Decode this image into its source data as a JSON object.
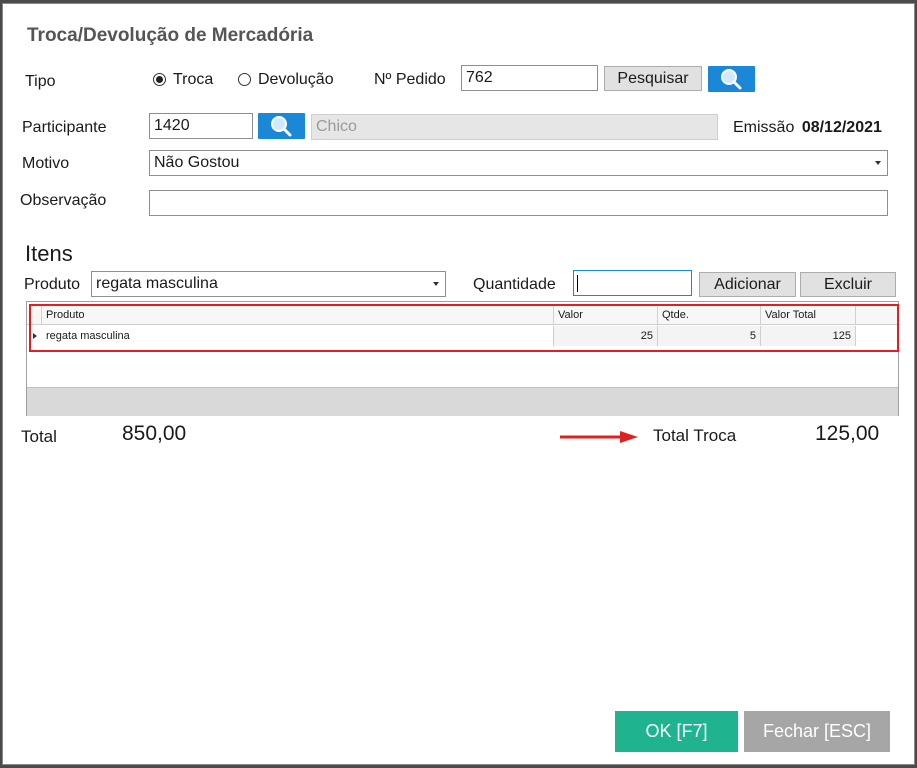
{
  "dialog": {
    "title": "Troca/Devolução de Mercadória"
  },
  "tipo": {
    "label": "Tipo",
    "options": [
      "Troca",
      "Devolução"
    ],
    "selected": "Troca"
  },
  "pedido": {
    "label": "Nº Pedido",
    "value": "762",
    "search_label": "Pesquisar"
  },
  "participante": {
    "label": "Participante",
    "code": "1420",
    "name": "Chico"
  },
  "emissao": {
    "label": "Emissão",
    "value": "08/12/2021"
  },
  "motivo": {
    "label": "Motivo",
    "value": "Não Gostou"
  },
  "observacao": {
    "label": "Observação",
    "value": ""
  },
  "itens": {
    "heading": "Itens",
    "produto_label": "Produto",
    "produto_value": "regata masculina",
    "quantidade_label": "Quantidade",
    "quantidade_value": "",
    "add_label": "Adicionar",
    "delete_label": "Excluir"
  },
  "table": {
    "columns": [
      "Produto",
      "Valor",
      "Qtde.",
      "Valor Total"
    ],
    "rows": [
      {
        "produto": "regata masculina",
        "valor": "25",
        "qtde": "5",
        "valor_total": "125"
      }
    ]
  },
  "totals": {
    "total_label": "Total",
    "total_value": "850,00",
    "troca_label": "Total Troca",
    "troca_value": "125,00"
  },
  "buttons": {
    "ok": "OK [F7]",
    "close": "Fechar [ESC]"
  },
  "colors": {
    "accent_blue": "#1a88d6",
    "ok_green": "#1fb38f",
    "highlight_red": "#e02020"
  },
  "icons": {
    "search": "magnifier-icon",
    "annotation": "red-arrow"
  }
}
